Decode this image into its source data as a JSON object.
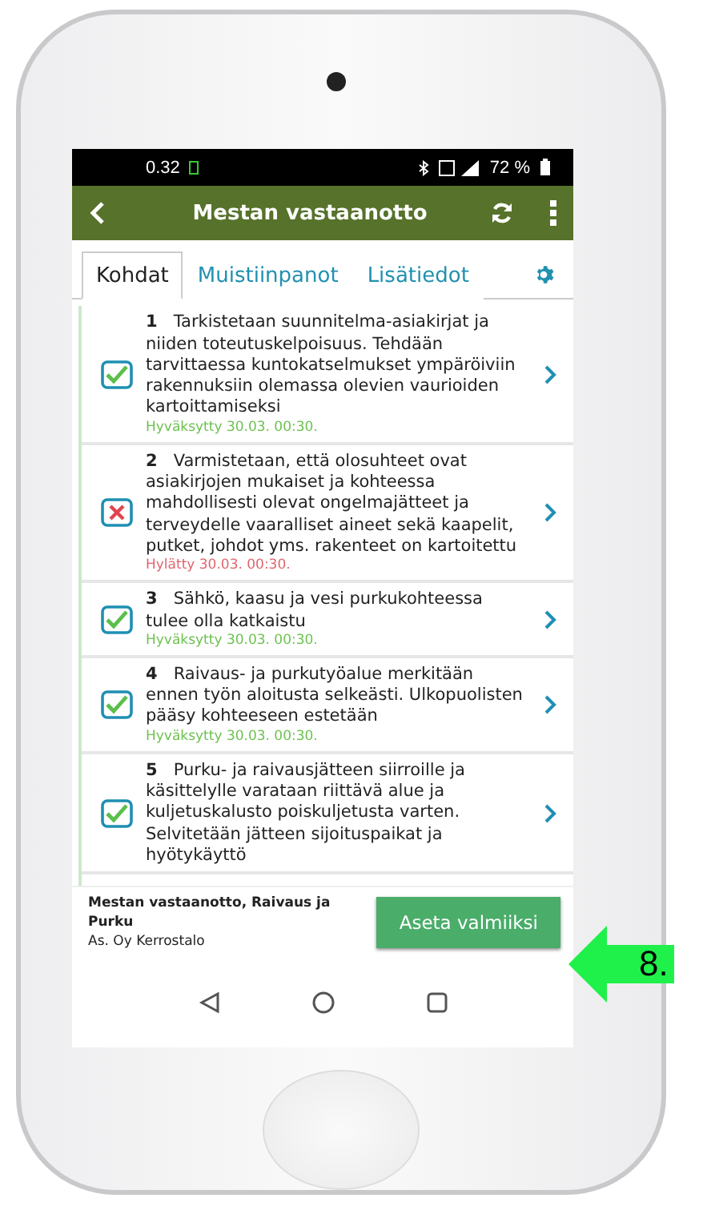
{
  "status_bar": {
    "time": "0.32",
    "battery": "72 %"
  },
  "header": {
    "title": "Mestan vastaanotto"
  },
  "tabs": [
    {
      "label": "Kohdat",
      "selected": true
    },
    {
      "label": "Muistiinpanot",
      "selected": false
    },
    {
      "label": "Lisätiedot",
      "selected": false
    }
  ],
  "items": [
    {
      "number": "1",
      "text": "Tarkistetaan suunnitelma-asiakirjat ja niiden toteutuskelpoisuus. Tehdään tarvittaessa kuntokatselmukset ympäröiviin rakennuksiin olemassa olevien vaurioiden kartoittamiseksi",
      "status": "Hyväksytty 30.03. 00:30.",
      "approved": true
    },
    {
      "number": "2",
      "text": "Varmistetaan, että olosuhteet ovat asiakirjojen mukaiset ja kohteessa mahdollisesti olevat ongelmajätteet ja terveydelle vaaralliset aineet sekä kaapelit, putket, johdot yms. rakenteet on kartoitettu",
      "status": "Hylätty 30.03. 00:30.",
      "approved": false
    },
    {
      "number": "3",
      "text": "Sähkö, kaasu ja vesi purkukohteessa tulee olla katkaistu",
      "status": "Hyväksytty 30.03. 00:30.",
      "approved": true
    },
    {
      "number": "4",
      "text": "Raivaus- ja purkutyöalue merkitään ennen työn aloitusta selkeästi. Ulkopuolisten pääsy kohteeseen estetään",
      "status": "Hyväksytty 30.03. 00:30.",
      "approved": true
    },
    {
      "number": "5",
      "text": "Purku- ja raivausjätteen siirroille ja käsittelylle varataan riittävä alue ja kuljetuskalusto poiskuljetusta varten. Selvitetään jätteen sijoituspaikat ja hyötykäyttö",
      "approved": true
    }
  ],
  "footer": {
    "title": "Mestan vastaanotto, Raivaus ja Purku",
    "subtitle": "As. Oy Kerrostalo",
    "button": "Aseta valmiiksi"
  },
  "callout": {
    "label": "8."
  }
}
